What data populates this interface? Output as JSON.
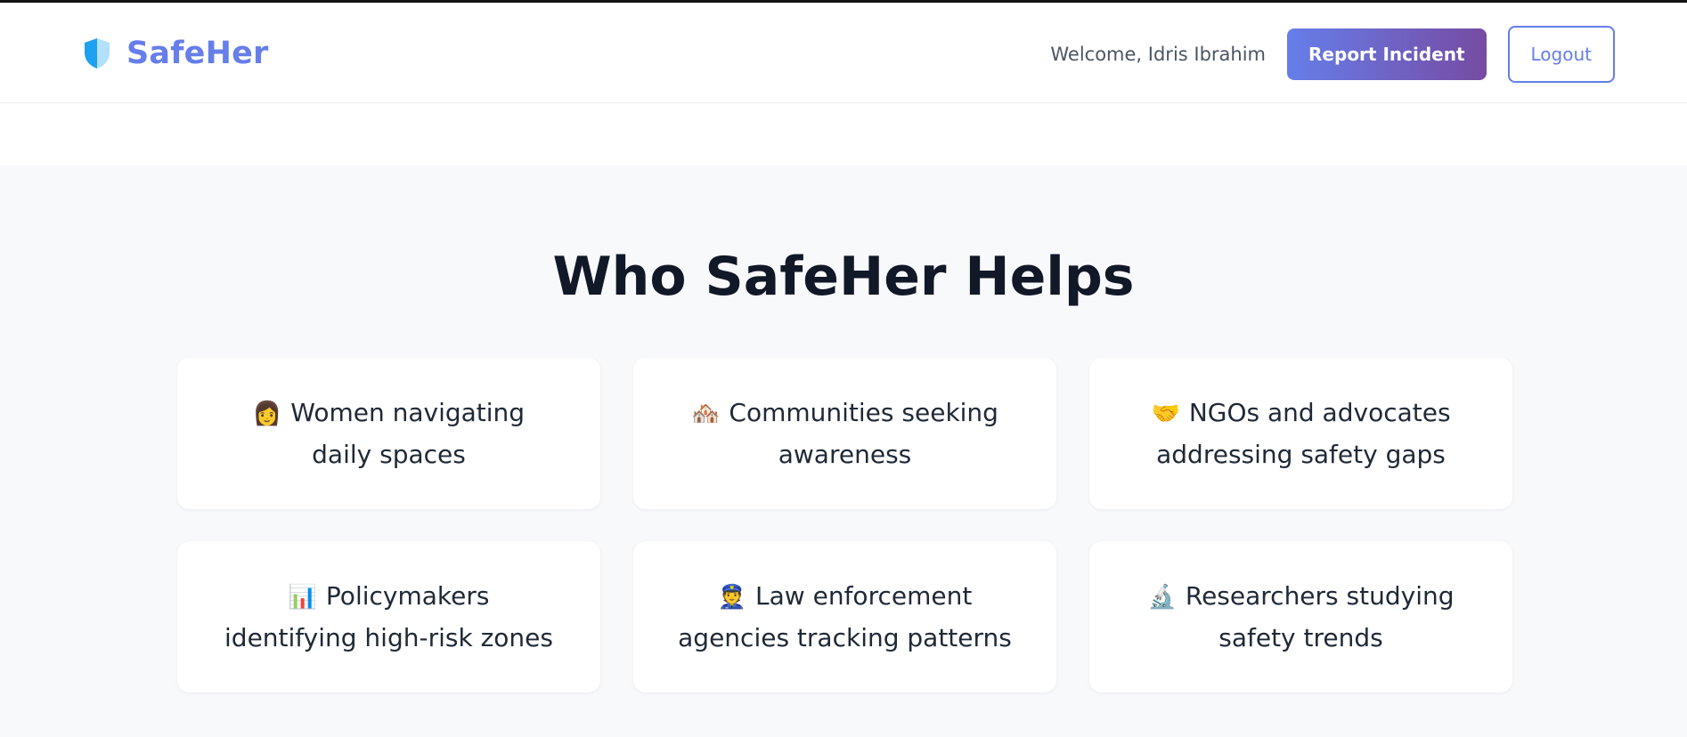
{
  "header": {
    "brand_name": "SafeHer",
    "brand_icon": "shield-icon",
    "welcome_text": "Welcome, Idris Ibrahim",
    "report_button_label": "Report Incident",
    "logout_button_label": "Logout"
  },
  "section": {
    "title": "Who SafeHer Helps",
    "cards": [
      {
        "emoji": "👩",
        "icon": "woman-icon",
        "text": "Women navigating daily spaces"
      },
      {
        "emoji": "🏘️",
        "icon": "houses-icon",
        "text": "Communities seeking awareness"
      },
      {
        "emoji": "🤝",
        "icon": "handshake-icon",
        "text": "NGOs and advocates addressing safety gaps"
      },
      {
        "emoji": "📊",
        "icon": "bar-chart-icon",
        "text": "Policymakers identifying high-risk zones"
      },
      {
        "emoji": "👮",
        "icon": "police-officer-icon",
        "text": "Law enforcement agencies tracking patterns"
      },
      {
        "emoji": "🔬",
        "icon": "microscope-icon",
        "text": "Researchers studying safety trends"
      }
    ]
  },
  "colors": {
    "brand": "#667eea",
    "gradient_end": "#764ba2",
    "section_background": "#f8f9fb",
    "title_text": "#111827"
  }
}
